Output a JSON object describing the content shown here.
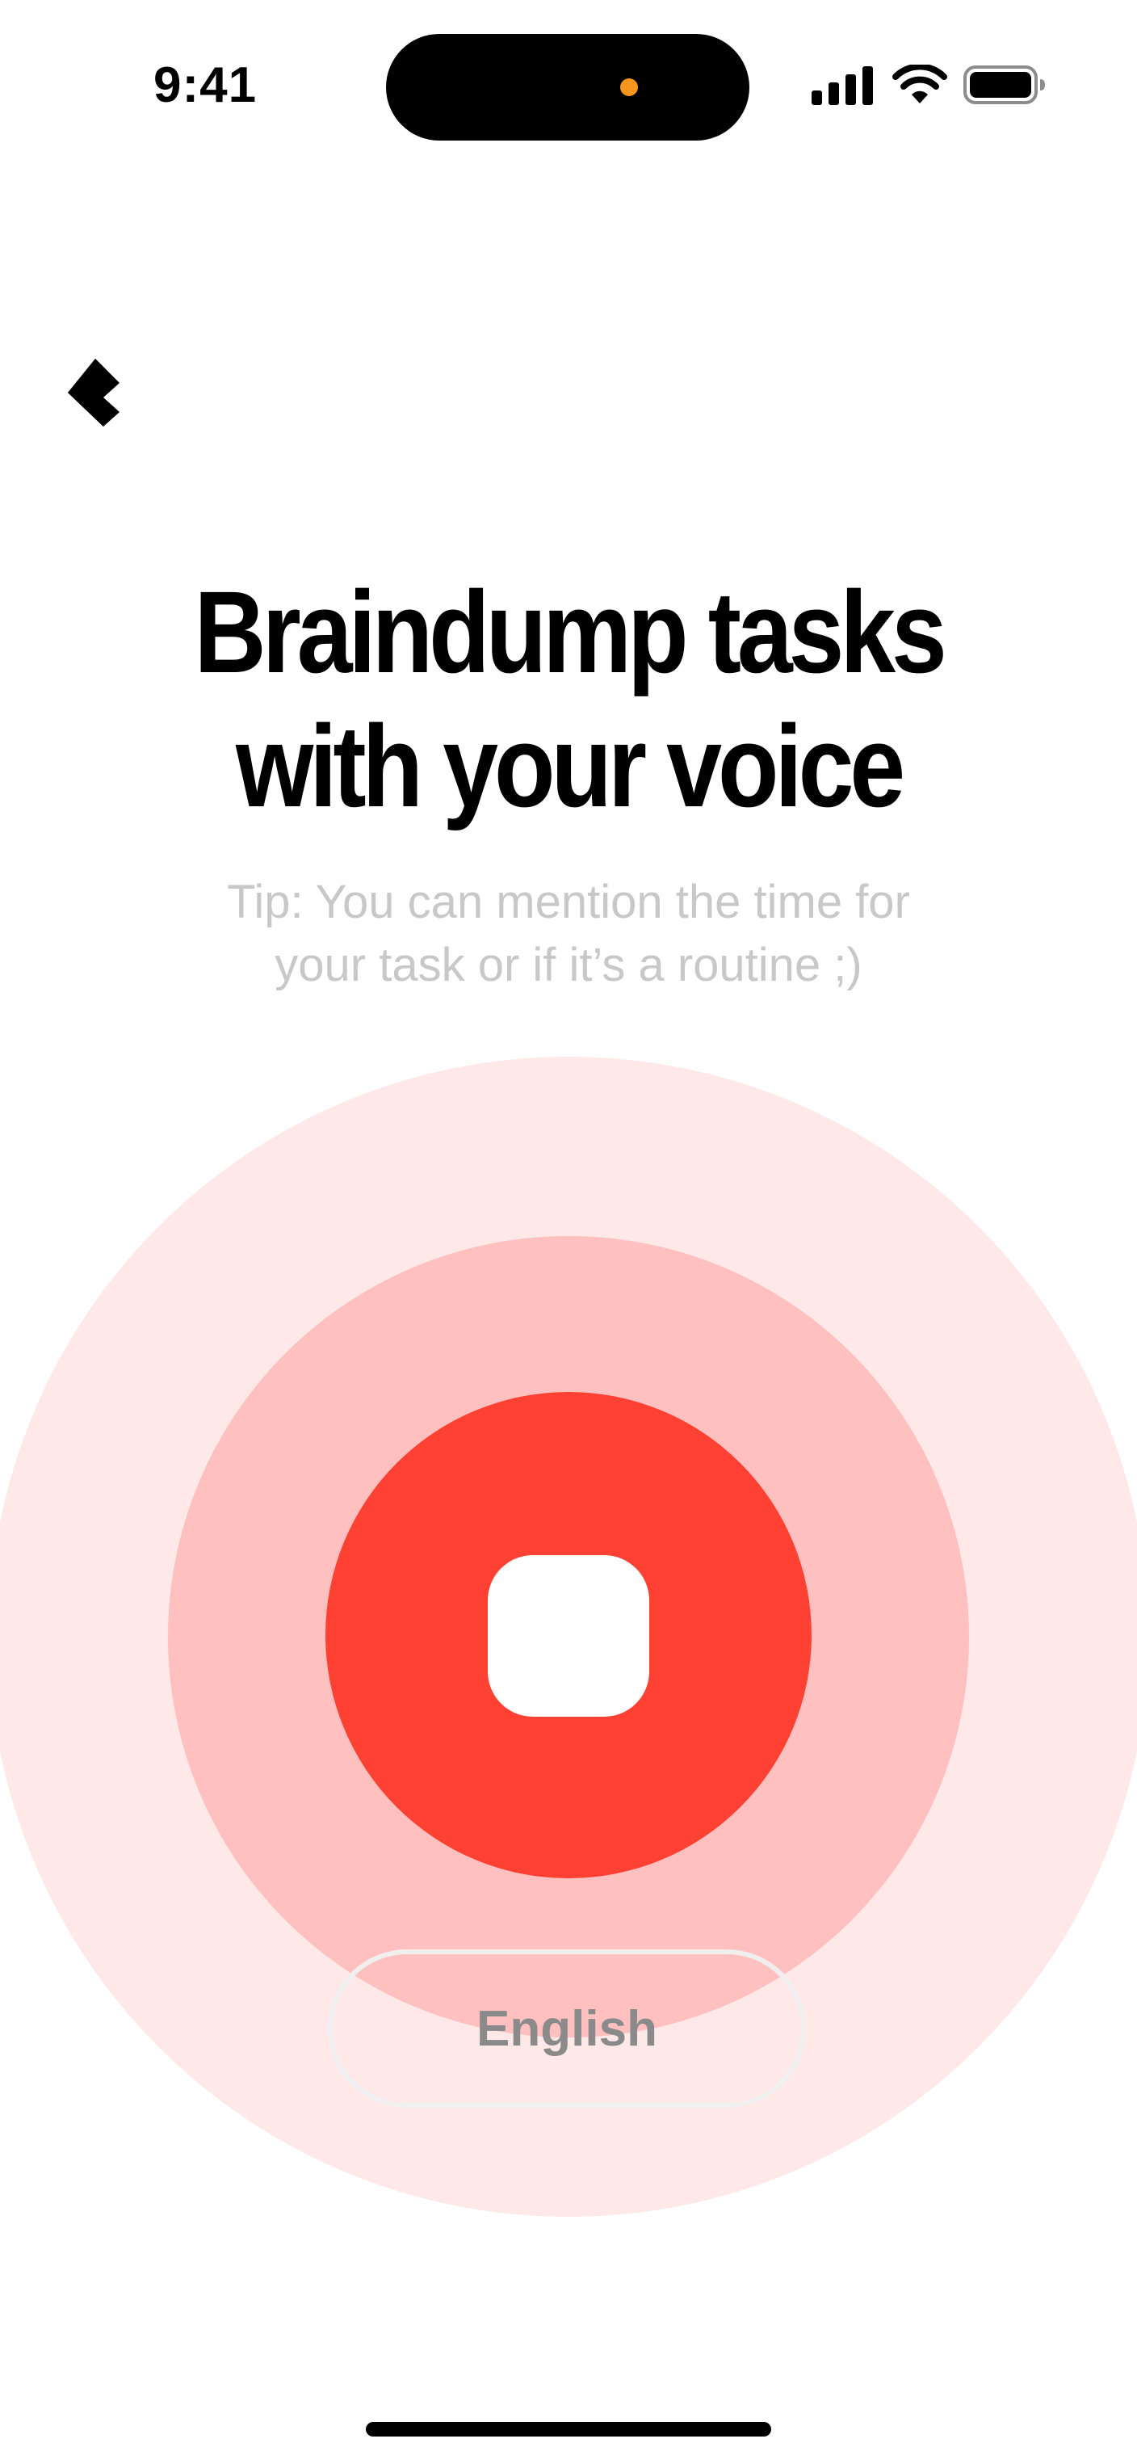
{
  "status_bar": {
    "time": "9:41"
  },
  "header": {
    "back_icon": "chevron-left-icon"
  },
  "main": {
    "title_line1": "Braindump tasks",
    "title_line2": "with your voice",
    "tip_line1": "Tip: You can mention the time for",
    "tip_line2": "your task or if it’s a routine ;)",
    "record_button_icon": "stop-icon",
    "language_label": "English"
  },
  "colors": {
    "accent": "#ff4134",
    "ring_middle": "#ffc0bf",
    "ring_outer": "#ffe8e8",
    "tip_text": "#c8c8c8",
    "island_indicator": "#f7961d"
  }
}
